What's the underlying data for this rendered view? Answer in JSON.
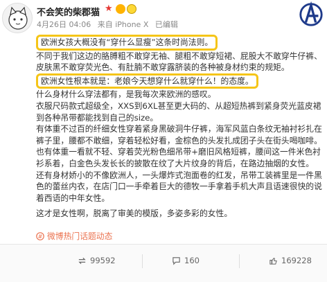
{
  "post": {
    "username": "不会笑的柴郡猫",
    "date": "4月26日 04:06",
    "source": "来自 iPhone X",
    "edited": "已编辑",
    "paragraphs": [
      "欧洲女孩大概没有“穿什么显瘦”这条时尚法则。",
      "不同于我们这边的胳膊粗不敢穿无袖、腿粗不敢穿短裙、屁股大不敢穿牛仔裤、皮肤黑不敢穿荧光色、有肚腩不敢穿露脐装的各种被身材约束的规矩。",
      "欧洲女性根本就是：老娘今天想穿什么就穿什么！的态度。",
      "什么身材什么穿法都有，是我每次来欧洲的感叹。",
      "衣服尺码款式超级全，XXS到6XL甚至更大码的、从超短热裤到紧身荧光蓝皮裙到各种吊带都能找到自己的size。",
      "有体重不过百的纤细女性穿着紧身黑破洞牛仔裤，海军风蓝白条纹无袖衬衫扎在裤子里，腰都不敢细，穿着轻松好看，金棕色的头发扎成团子头在街头喝咖啡。",
      "也有体重一看就不轻、穿着荧光粉色细吊带+磨旧风格短裤，腰间这一件米色衬衫系着，白金色头发长长的披散在纹了大片纹身的背后，在路边抽烟的女性。",
      "还有身材娇小的不像欧洲人，一头爆炸式泡面卷的红发，吊带工装裤里是一件黑色的蕾丝内衣，在店门口一手牵着巨大的德牧一手拿着手机大声且语速很快的说着西语的中年女性。",
      "这才是女性啊，脱离了审美的模版，多姿多彩的女性。"
    ],
    "hashtag": "微博热门话题动态"
  },
  "stats": {
    "reposts": "99592",
    "comments": "160",
    "likes": "169228"
  },
  "colors": {
    "highlight_box": "#f5c518",
    "hashtag": "#eb7350",
    "brand": "#1e3a8a"
  },
  "icons": {
    "avatar": "cat-avatar",
    "brand": "avengers-logo",
    "repost": "repost-icon",
    "comment": "comment-icon",
    "like": "like-icon",
    "hashtag": "hashtag-icon"
  }
}
